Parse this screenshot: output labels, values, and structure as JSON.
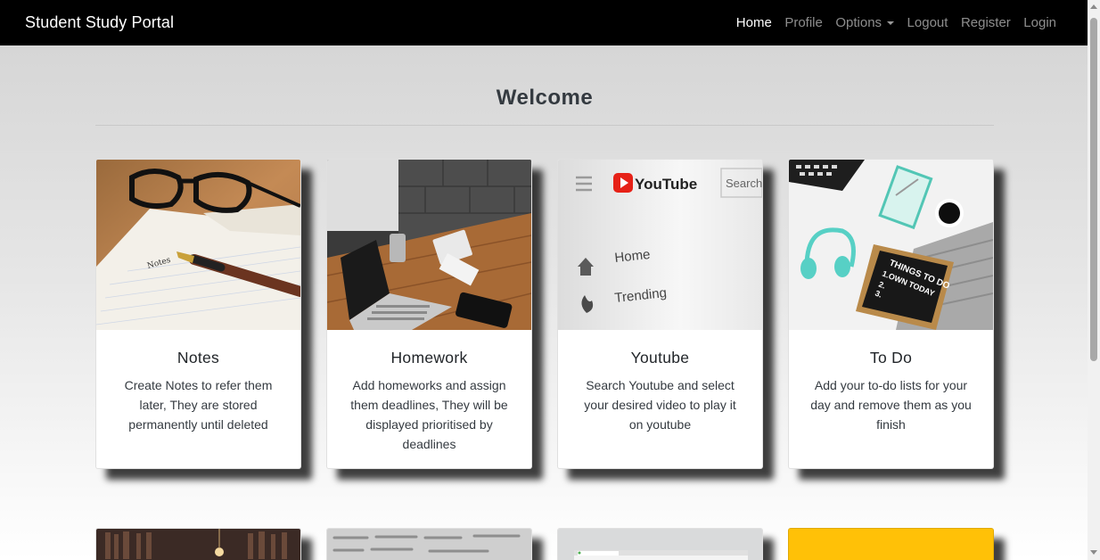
{
  "navbar": {
    "brand": "Student Study Portal",
    "links": {
      "home": "Home",
      "profile": "Profile",
      "options": "Options",
      "logout": "Logout",
      "register": "Register",
      "login": "Login"
    }
  },
  "main": {
    "heading": "Welcome",
    "cards": [
      {
        "title": "Notes",
        "text": "Create Notes to refer them later, They are stored permanently until deleted"
      },
      {
        "title": "Homework",
        "text": "Add homeworks and assign them deadlines, They will be displayed prioritised by deadlines"
      },
      {
        "title": "Youtube",
        "text": "Search Youtube and select your desired video to play it on youtube"
      },
      {
        "title": "To Do",
        "text": "Add your to-do lists for your day and remove them as you finish"
      }
    ]
  },
  "images": {
    "youtube": {
      "logo": "YouTube",
      "search": "Search",
      "home": "Home",
      "trending": "Trending"
    },
    "todo": {
      "board_line1": "THINGS TO DO",
      "board_line2": "1.OWN TODAY",
      "board_line3": "2.",
      "board_line4": "3."
    },
    "notes": {
      "label": "Notes"
    }
  },
  "colors": {
    "navbar_bg": "#000000",
    "shadow": "#000000",
    "accent_yellow": "#ffc107"
  }
}
